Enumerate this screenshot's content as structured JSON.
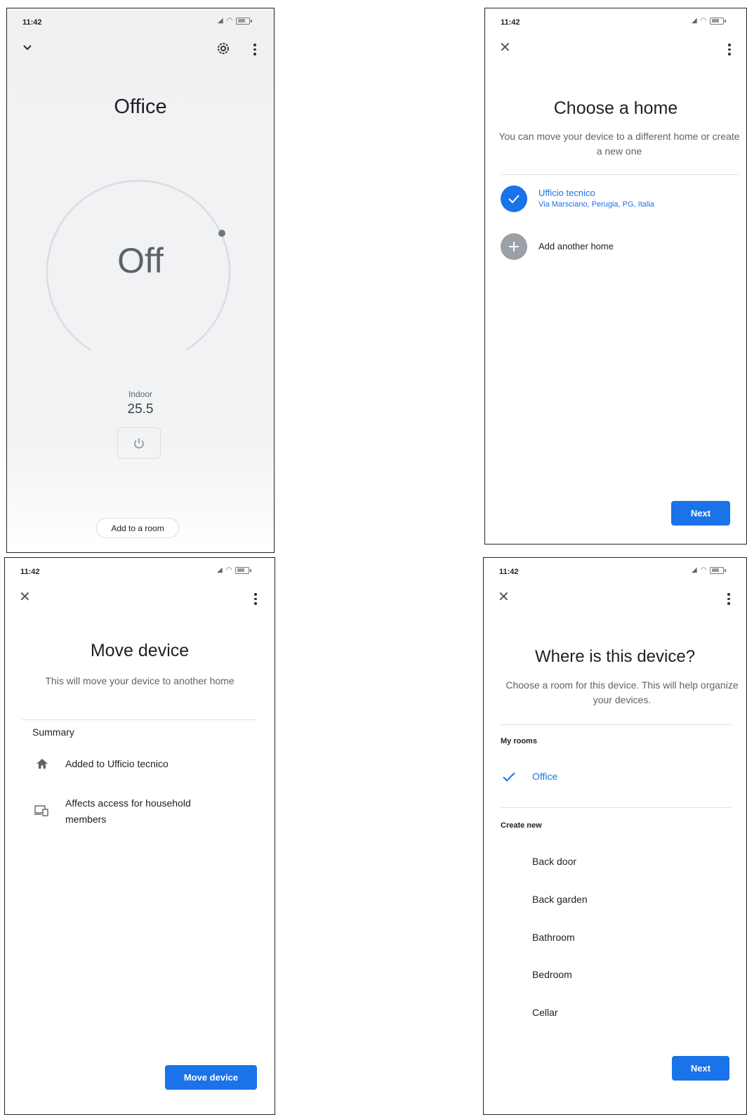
{
  "status_bar": {
    "time": "11:42"
  },
  "screen1": {
    "room_title": "Office",
    "state": "Off",
    "indoor_label": "Indoor",
    "indoor_value": "25.5",
    "add_room_button": "Add to a room",
    "icons": [
      "chevron-down-icon",
      "gear-icon",
      "more-vert-icon",
      "power-icon"
    ]
  },
  "screen2": {
    "title": "Choose a home",
    "subtitle": "You can move your device to a different home or create a new one",
    "homes": [
      {
        "name": "Ufficio tecnico",
        "address": "Via Marsciano, Perugia, PG, Italia",
        "selected": true
      }
    ],
    "add_home_label": "Add another home",
    "next_button": "Next",
    "accent_color": "#1a73e8"
  },
  "screen3": {
    "title": "Move device",
    "subtitle": "This will move your device to another home",
    "summary_heading": "Summary",
    "summary_items": [
      {
        "icon": "home-icon",
        "text": "Added to Ufficio tecnico"
      },
      {
        "icon": "devices-icon",
        "text": "Affects access for household members"
      }
    ],
    "move_button": "Move device"
  },
  "screen4": {
    "title": "Where is this device?",
    "subtitle": "Choose a room for this device. This will help organize your devices.",
    "my_rooms_heading": "My rooms",
    "my_rooms": [
      {
        "name": "Office",
        "selected": true
      }
    ],
    "create_new_heading": "Create new",
    "new_rooms": [
      "Back door",
      "Back garden",
      "Bathroom",
      "Bedroom",
      "Cellar"
    ],
    "next_button": "Next"
  }
}
